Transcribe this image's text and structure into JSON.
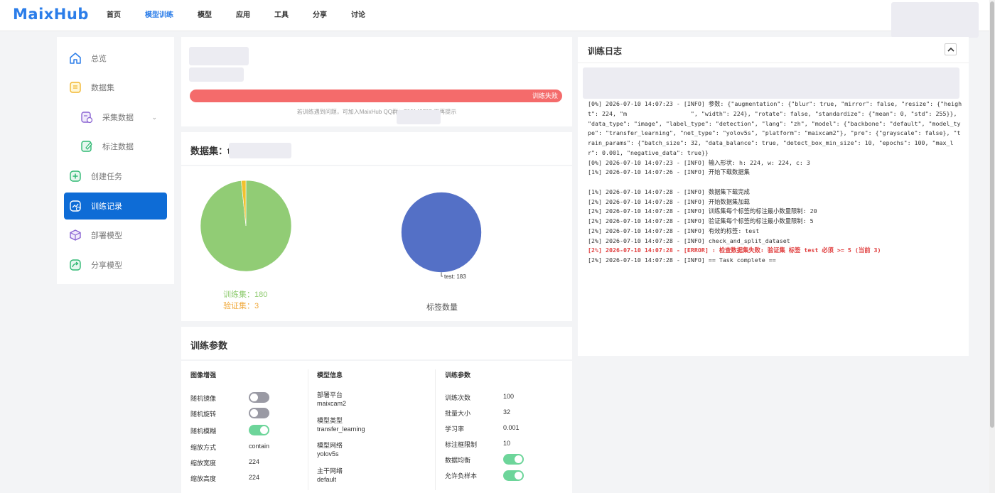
{
  "brand": {
    "name": "MaixHub"
  },
  "nav": {
    "items": [
      "首页",
      "模型训练",
      "模型",
      "应用",
      "工具",
      "分享",
      "讨论"
    ],
    "active_index": 1
  },
  "sidebar": {
    "items": [
      {
        "label": "总览",
        "icon": "home-icon"
      },
      {
        "label": "数据集",
        "icon": "dataset-icon"
      },
      {
        "label": "采集数据",
        "icon": "collect-icon"
      },
      {
        "label": "标注数据",
        "icon": "annotate-icon"
      },
      {
        "label": "创建任务",
        "icon": "plus-icon"
      },
      {
        "label": "训练记录",
        "icon": "record-icon"
      },
      {
        "label": "部署模型",
        "icon": "cube-icon"
      },
      {
        "label": "分享模型",
        "icon": "share-icon"
      }
    ],
    "active_index": 5
  },
  "status": {
    "progress_label": "训练失败",
    "progress_percent": 100,
    "hint": "若训练遇到问题，可加入MaixHub QQ群：76614979​5   不再提示"
  },
  "dataset": {
    "title": "数据集：t",
    "split_legend": {
      "train": "训练集：180",
      "val": "验证集：3"
    },
    "label_caption": "标签数量",
    "label_pie_label": "test: 183"
  },
  "chart_data": [
    {
      "type": "pie",
      "categories": [
        "训练集",
        "验证集"
      ],
      "values": [
        180,
        3
      ],
      "colors": [
        "#91cc75",
        "#f2c12e"
      ]
    },
    {
      "type": "pie",
      "title": "标签数量",
      "categories": [
        "test"
      ],
      "values": [
        183
      ],
      "colors": [
        "#5470c6"
      ]
    }
  ],
  "params": {
    "title": "训练参数",
    "augment": {
      "title": "图像增强",
      "rows": [
        {
          "label": "随机镜像",
          "toggle": false
        },
        {
          "label": "随机旋转",
          "toggle": false
        },
        {
          "label": "随机模糊",
          "toggle": true
        },
        {
          "label": "缩放方式",
          "value": "contain"
        },
        {
          "label": "缩放宽度",
          "value": "224"
        },
        {
          "label": "缩放高度",
          "value": "224"
        }
      ]
    },
    "model": {
      "title": "模型信息",
      "rows": [
        {
          "label": "部署平台",
          "value": "maixcam2"
        },
        {
          "label": "模型类型",
          "value": "transfer_learning"
        },
        {
          "label": "模型网络",
          "value": "yolov5s"
        },
        {
          "label": "主干网络",
          "value": "default"
        }
      ]
    },
    "train": {
      "title": "训练参数",
      "rows": [
        {
          "label": "训练次数",
          "value": "100"
        },
        {
          "label": "批量大小",
          "value": "32"
        },
        {
          "label": "学习率",
          "value": "0.001"
        },
        {
          "label": "标注框限制",
          "value": "10"
        },
        {
          "label": "数据均衡",
          "toggle": true
        },
        {
          "label": "允许负样本",
          "toggle": true
        }
      ]
    }
  },
  "log": {
    "title": "训练日志",
    "lines": [
      {
        "text": "[0%] 2026-07-10 14:07:23 - [INFO] 参数: {\"augmentation\": {\"blur\": true, \"mirror\": false, \"resize\": {\"height\": 224, \"m                  \", \"width\": 224}, \"rotate\": false, \"standardize\": {\"mean\": 0, \"std\": 255}}, \"data_type\": \"image\", \"label_type\": \"detection\", \"lang\": \"zh\", \"model\": {\"backbone\": \"default\", \"model_type\": \"transfer_learning\", \"net_type\": \"yolov5s\", \"platform\": \"maixcam2\"}, \"pre\": {\"grayscale\": false}, \"train_params\": {\"batch_size\": 32, \"data_balance\": true, \"detect_box_min_size\": 10, \"epochs\": 100, \"max_lr\": 0.001, \"negative_data\": true}}",
        "level": "info"
      },
      {
        "text": "[0%] 2026-07-10 14:07:23 - [INFO] 输入形状: h: 224, w: 224, c: 3",
        "level": "info"
      },
      {
        "text": "[1%] 2026-07-10 14:07:26 - [INFO] 开始下载数据集",
        "level": "info"
      },
      {
        "text": " ",
        "level": "info"
      },
      {
        "text": "[1%] 2026-07-10 14:07:28 - [INFO] 数据集下载完成",
        "level": "info"
      },
      {
        "text": "[2%] 2026-07-10 14:07:28 - [INFO] 开始数据集加载",
        "level": "info"
      },
      {
        "text": "[2%] 2026-07-10 14:07:28 - [INFO] 训练集每个标签的标注最小数量限制: 20",
        "level": "info"
      },
      {
        "text": "[2%] 2026-07-10 14:07:28 - [INFO] 验证集每个标签的标注最小数量限制: 5",
        "level": "info"
      },
      {
        "text": "[2%] 2026-07-10 14:07:28 - [INFO] 有效的标签: test",
        "level": "info"
      },
      {
        "text": "[2%] 2026-07-10 14:07:28 - [INFO] check_and_split_dataset",
        "level": "info"
      },
      {
        "text": "[2%] 2026-07-10 14:07:28 - [ERROR] : 检查数据集失败: 验证集 标签 test 必须 >= 5 (当前 3)",
        "level": "error"
      },
      {
        "text": "[2%] 2026-07-10 14:07:28 - [INFO] == Task complete ==",
        "level": "info"
      }
    ]
  }
}
